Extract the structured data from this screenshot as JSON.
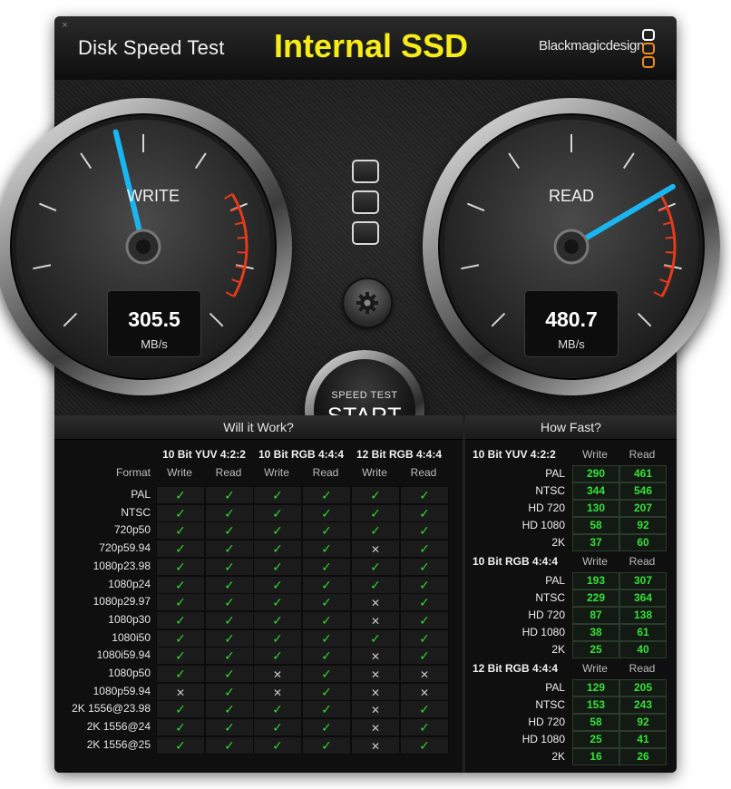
{
  "window": {
    "app_title": "Disk Speed Test",
    "disk_name": "Internal SSD",
    "brand": "Blackmagicdesign",
    "close_glyph": "×"
  },
  "gauges": {
    "write": {
      "label": "WRITE",
      "value": "305.5",
      "unit": "MB/s",
      "needle_fraction": 0.45
    },
    "read": {
      "label": "READ",
      "value": "480.7",
      "unit": "MB/s",
      "needle_fraction": 0.72
    }
  },
  "controls": {
    "start_small": "SPEED TEST",
    "start_big": "START",
    "settings_icon": "gear-icon"
  },
  "will_it_work": {
    "title": "Will it Work?",
    "format_header": "Format",
    "groups": [
      "10 Bit YUV 4:2:2",
      "10 Bit RGB 4:4:4",
      "12 Bit RGB 4:4:4"
    ],
    "sub_headers": [
      "Write",
      "Read"
    ],
    "rows": [
      {
        "format": "PAL",
        "cells": [
          "ok",
          "ok",
          "ok",
          "ok",
          "ok",
          "ok"
        ]
      },
      {
        "format": "NTSC",
        "cells": [
          "ok",
          "ok",
          "ok",
          "ok",
          "ok",
          "ok"
        ]
      },
      {
        "format": "720p50",
        "cells": [
          "ok",
          "ok",
          "ok",
          "ok",
          "ok",
          "ok"
        ]
      },
      {
        "format": "720p59.94",
        "cells": [
          "ok",
          "ok",
          "ok",
          "ok",
          "no",
          "ok"
        ]
      },
      {
        "format": "1080p23.98",
        "cells": [
          "ok",
          "ok",
          "ok",
          "ok",
          "ok",
          "ok"
        ]
      },
      {
        "format": "1080p24",
        "cells": [
          "ok",
          "ok",
          "ok",
          "ok",
          "ok",
          "ok"
        ]
      },
      {
        "format": "1080p29.97",
        "cells": [
          "ok",
          "ok",
          "ok",
          "ok",
          "no",
          "ok"
        ]
      },
      {
        "format": "1080p30",
        "cells": [
          "ok",
          "ok",
          "ok",
          "ok",
          "no",
          "ok"
        ]
      },
      {
        "format": "1080i50",
        "cells": [
          "ok",
          "ok",
          "ok",
          "ok",
          "ok",
          "ok"
        ]
      },
      {
        "format": "1080i59.94",
        "cells": [
          "ok",
          "ok",
          "ok",
          "ok",
          "no",
          "ok"
        ]
      },
      {
        "format": "1080p50",
        "cells": [
          "ok",
          "ok",
          "no",
          "ok",
          "no",
          "no"
        ]
      },
      {
        "format": "1080p59.94",
        "cells": [
          "no",
          "ok",
          "no",
          "ok",
          "no",
          "no"
        ]
      },
      {
        "format": "2K 1556@23.98",
        "cells": [
          "ok",
          "ok",
          "ok",
          "ok",
          "no",
          "ok"
        ]
      },
      {
        "format": "2K 1556@24",
        "cells": [
          "ok",
          "ok",
          "ok",
          "ok",
          "no",
          "ok"
        ]
      },
      {
        "format": "2K 1556@25",
        "cells": [
          "ok",
          "ok",
          "ok",
          "ok",
          "no",
          "ok"
        ]
      }
    ],
    "ok_glyph": "✓",
    "no_glyph": "✕"
  },
  "how_fast": {
    "title": "How Fast?",
    "sub_headers": [
      "Write",
      "Read"
    ],
    "groups": [
      {
        "name": "10 Bit YUV 4:2:2",
        "rows": [
          {
            "format": "PAL",
            "write": "290",
            "read": "461"
          },
          {
            "format": "NTSC",
            "write": "344",
            "read": "546"
          },
          {
            "format": "HD 720",
            "write": "130",
            "read": "207"
          },
          {
            "format": "HD 1080",
            "write": "58",
            "read": "92"
          },
          {
            "format": "2K",
            "write": "37",
            "read": "60"
          }
        ]
      },
      {
        "name": "10 Bit RGB 4:4:4",
        "rows": [
          {
            "format": "PAL",
            "write": "193",
            "read": "307"
          },
          {
            "format": "NTSC",
            "write": "229",
            "read": "364"
          },
          {
            "format": "HD 720",
            "write": "87",
            "read": "138"
          },
          {
            "format": "HD 1080",
            "write": "38",
            "read": "61"
          },
          {
            "format": "2K",
            "write": "25",
            "read": "40"
          }
        ]
      },
      {
        "name": "12 Bit RGB 4:4:4",
        "rows": [
          {
            "format": "PAL",
            "write": "129",
            "read": "205"
          },
          {
            "format": "NTSC",
            "write": "153",
            "read": "243"
          },
          {
            "format": "HD 720",
            "write": "58",
            "read": "92"
          },
          {
            "format": "HD 1080",
            "write": "25",
            "read": "41"
          },
          {
            "format": "2K",
            "write": "16",
            "read": "26"
          }
        ]
      }
    ]
  },
  "colors": {
    "title_accent": "#f6ec1a",
    "needle": "#19b6f2",
    "redline": "#e53a1c",
    "ok": "#33d42f",
    "speed_value": "#36e03a"
  }
}
